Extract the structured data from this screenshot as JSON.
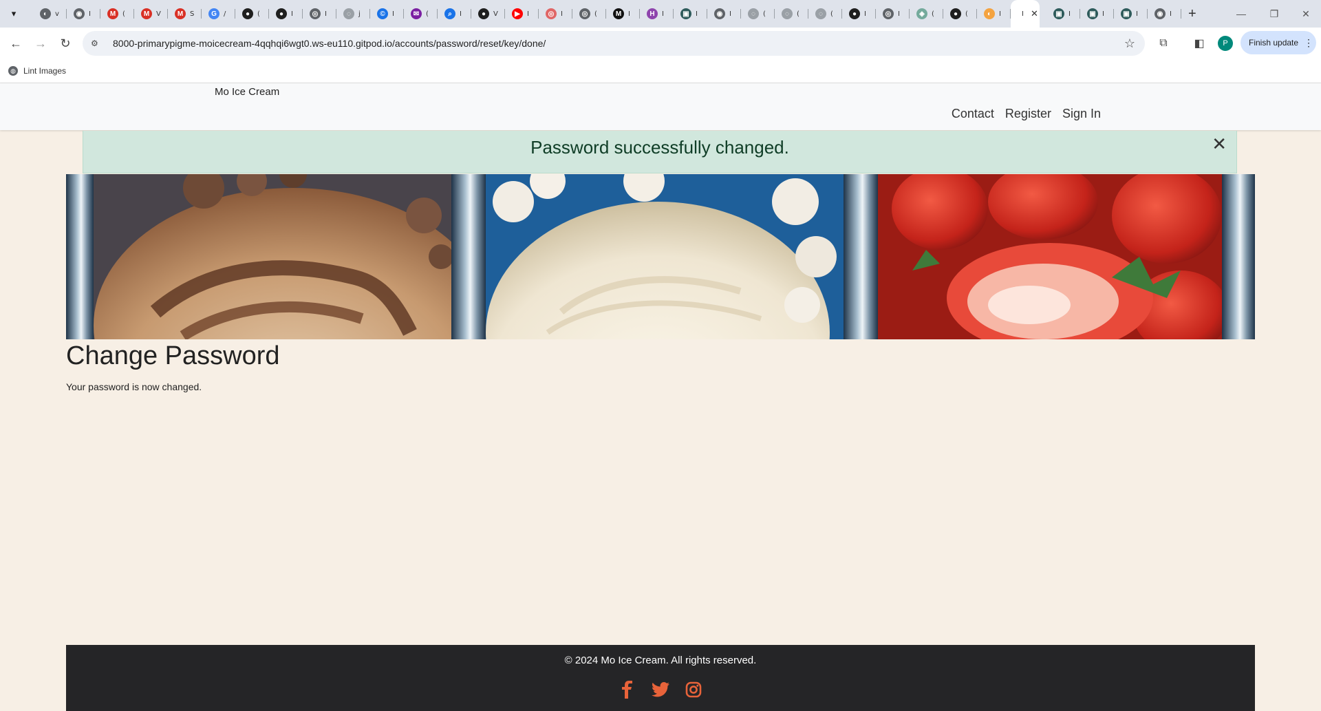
{
  "browser": {
    "tabs": [
      {
        "icon": "chrome-icon",
        "color": "#5f6368",
        "glyph": "◐",
        "text": "v"
      },
      {
        "icon": "settings-icon",
        "color": "#5f6368",
        "glyph": "◉",
        "text": "I"
      },
      {
        "icon": "gmail-icon",
        "color": "#d93025",
        "glyph": "M",
        "text": "("
      },
      {
        "icon": "gmail-icon",
        "color": "#d93025",
        "glyph": "M",
        "text": "V"
      },
      {
        "icon": "gmail-icon",
        "color": "#d93025",
        "glyph": "M",
        "text": "S"
      },
      {
        "icon": "google-icon",
        "color": "#4285f4",
        "glyph": "G",
        "text": "/"
      },
      {
        "icon": "github-icon",
        "color": "#1f1f1f",
        "glyph": "●",
        "text": "("
      },
      {
        "icon": "github-icon",
        "color": "#1f1f1f",
        "glyph": "●",
        "text": "I"
      },
      {
        "icon": "settings-icon",
        "color": "#5f6368",
        "glyph": "◎",
        "text": "I"
      },
      {
        "icon": "globe-icon",
        "color": "#9aa0a6",
        "glyph": "◌",
        "text": "j"
      },
      {
        "icon": "copyright-icon",
        "color": "#1a73e8",
        "glyph": "©",
        "text": "I"
      },
      {
        "icon": "mail-icon",
        "color": "#7b1fa2",
        "glyph": "✉",
        "text": "("
      },
      {
        "icon": "search-icon",
        "color": "#1a73e8",
        "glyph": "⌕",
        "text": "I"
      },
      {
        "icon": "github-icon",
        "color": "#1f1f1f",
        "glyph": "●",
        "text": "V"
      },
      {
        "icon": "youtube-icon",
        "color": "#ff0000",
        "glyph": "▶",
        "text": "I"
      },
      {
        "icon": "target-icon",
        "color": "#e06666",
        "glyph": "◎",
        "text": "I"
      },
      {
        "icon": "settings-icon",
        "color": "#5f6368",
        "glyph": "◎",
        "text": "("
      },
      {
        "icon": "medium-icon",
        "color": "#111111",
        "glyph": "M",
        "text": "I"
      },
      {
        "icon": "h-icon",
        "color": "#8e44ad",
        "glyph": "H",
        "text": "I"
      },
      {
        "icon": "image-icon",
        "color": "#2e5b5b",
        "glyph": "▣",
        "text": "I"
      },
      {
        "icon": "settings-icon",
        "color": "#5f6368",
        "glyph": "◉",
        "text": "I"
      },
      {
        "icon": "globe-icon",
        "color": "#9aa0a6",
        "glyph": "◌",
        "text": "("
      },
      {
        "icon": "globe-icon",
        "color": "#9aa0a6",
        "glyph": "◌",
        "text": "("
      },
      {
        "icon": "globe-icon",
        "color": "#9aa0a6",
        "glyph": "◌",
        "text": "("
      },
      {
        "icon": "github-icon",
        "color": "#1f1f1f",
        "glyph": "●",
        "text": "I"
      },
      {
        "icon": "settings-icon",
        "color": "#5f6368",
        "glyph": "◎",
        "text": "I"
      },
      {
        "icon": "chatgpt-icon",
        "color": "#74aa9c",
        "glyph": "◈",
        "text": "("
      },
      {
        "icon": "github-icon",
        "color": "#1f1f1f",
        "glyph": "●",
        "text": "("
      },
      {
        "icon": "orange-icon",
        "color": "#f4a340",
        "glyph": "◐",
        "text": "I"
      }
    ],
    "active_tab": {
      "text": "I"
    },
    "tabs_after": [
      {
        "icon": "image-icon",
        "color": "#2e5b5b",
        "glyph": "▣",
        "text": "I"
      },
      {
        "icon": "image-icon",
        "color": "#2e5b5b",
        "glyph": "▣",
        "text": "I"
      },
      {
        "icon": "image-icon",
        "color": "#2e5b5b",
        "glyph": "▣",
        "text": "I"
      },
      {
        "icon": "settings-icon",
        "color": "#5f6368",
        "glyph": "◉",
        "text": "I"
      }
    ],
    "url": "8000-primarypigme-moicecream-4qqhqi6wgt0.ws-eu110.gitpod.io/accounts/password/reset/key/done/",
    "profile_initial": "P",
    "finish_update": "Finish update",
    "bookmark": "Lint Images"
  },
  "site": {
    "brand": "Mo Ice Cream",
    "nav": {
      "contact": "Contact",
      "register": "Register",
      "signin": "Sign In"
    },
    "alert": "Password successfully changed.",
    "page_title": "Change Password",
    "message": "Your password is now changed.",
    "footer": {
      "copyright": "© 2024 Mo Ice Cream. All rights reserved."
    },
    "social_color": "#e8633a"
  }
}
